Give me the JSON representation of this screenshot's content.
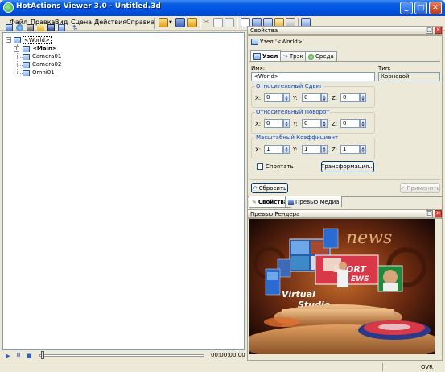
{
  "window": {
    "title": "HotActions Viewer 3.0 - Untitled.3d",
    "minimize_glyph": "_",
    "maximize_glyph": "□",
    "close_glyph": "✕"
  },
  "menu": [
    "Файл",
    "Правка",
    "Вид",
    "Сцена",
    "Действия",
    "Справка"
  ],
  "tree": {
    "root": "<World>",
    "children": [
      "<Main>",
      "Camera01",
      "Camera02",
      "Omni01"
    ]
  },
  "playbar": {
    "play_glyph": "▶",
    "pause_glyph": "II",
    "stop_glyph": "■",
    "time": "00:00:00:00"
  },
  "properties_panel": {
    "title": "Свойства",
    "node_caption": "Узел '<World>'",
    "tabs": [
      "Узел",
      "Трэк",
      "Среда"
    ],
    "name_label": "Имя:",
    "name_value": "<World>",
    "type_label": "Тип:",
    "type_value": "Корневой",
    "groups": [
      {
        "title": "Относительный Сдвиг",
        "x": "0",
        "y": "0",
        "z": "0"
      },
      {
        "title": "Относительный Поворот",
        "x": "0",
        "y": "0",
        "z": "0"
      },
      {
        "title": "Масштабный Коэффициент",
        "x": "1",
        "y": "1",
        "z": "1"
      }
    ],
    "axis_labels": [
      "X:",
      "Y:",
      "Z:"
    ],
    "hide_label": "Спрятать",
    "transform_button": "Трансформация...",
    "reset_button": "Сбросить",
    "apply_button": "Применить",
    "bottom_tabs": [
      "Свойства",
      "Превью Медиа"
    ]
  },
  "preview_panel": {
    "title": "Превью Рендера",
    "scene_text": {
      "news": "news",
      "sport": "SPORT",
      "ews": "EWS",
      "virtual": "Virtual",
      "studio": "Studio"
    }
  },
  "status": {
    "mode": "OVR"
  },
  "colors": {
    "title_bar": "#0054e3",
    "panel_bg": "#ece9d8",
    "group_label": "#0046d5"
  }
}
